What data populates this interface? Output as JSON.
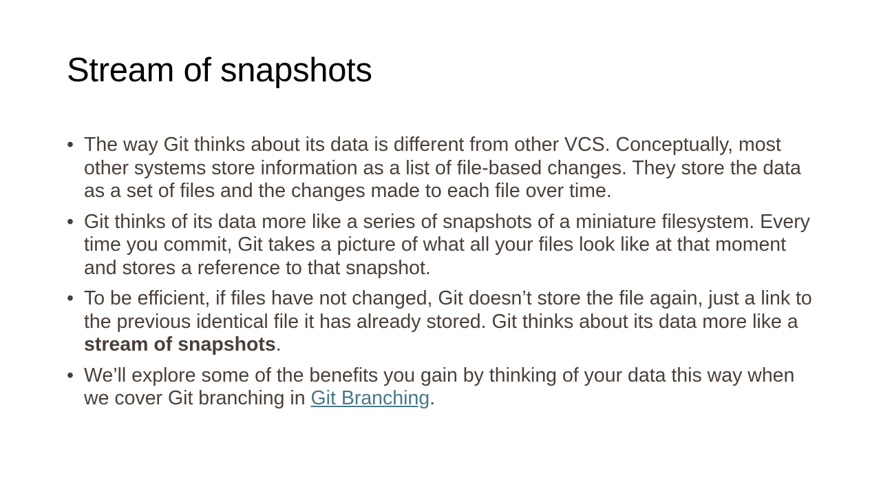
{
  "slide": {
    "title": "Stream of snapshots",
    "bullet_char": "•",
    "bullets": [
      {
        "text": "The way Git thinks about its data is different from other VCS. Conceptually, most other systems store information as a list of file-based changes. They store the data as a set of files and the changes made to each file over time."
      },
      {
        "text": "Git thinks of its data more like a series of snapshots of a miniature filesystem. Every time you commit, Git takes a picture of what all your files look like at that moment and stores a reference to that snapshot."
      },
      {
        "text_before": "To be efficient, if files have not changed, Git doesn’t store the file again, just a link to the previous identical file it has already stored. Git thinks about its data more like a ",
        "bold": "stream of snapshots",
        "text_after": "."
      },
      {
        "text_before": "We’ll explore some of the benefits you gain by thinking of your data this way when we cover Git branching in ",
        "link": "Git Branching",
        "text_after": "."
      }
    ]
  },
  "colors": {
    "title": "#000000",
    "body_text": "#4a3f38",
    "link": "#467886",
    "background": "#ffffff"
  }
}
